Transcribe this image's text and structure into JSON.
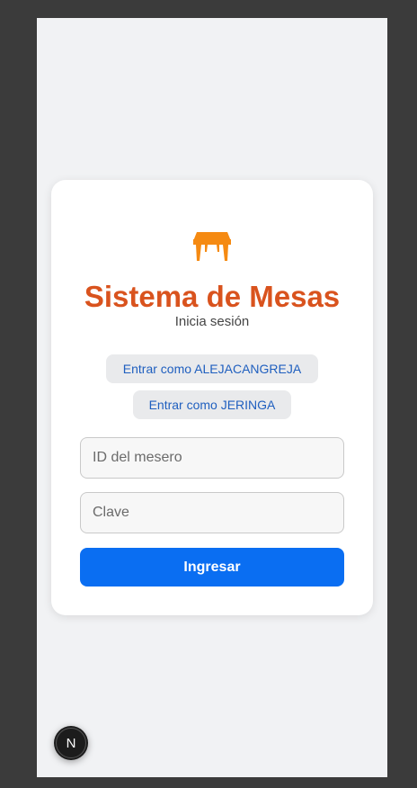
{
  "login": {
    "title": "Sistema de Mesas",
    "subtitle": "Inicia sesión",
    "quick_logins": [
      {
        "label": "Entrar como ALEJACANGREJA"
      },
      {
        "label": "Entrar como JERINGA"
      }
    ],
    "waiter_id": {
      "placeholder": "ID del mesero",
      "value": ""
    },
    "password": {
      "placeholder": "Clave",
      "value": ""
    },
    "submit_label": "Ingresar"
  },
  "dev_badge": {
    "letter": "N"
  },
  "colors": {
    "brand": "#d9531e",
    "logo": "#f58a12",
    "primary_button": "#0a6ef2",
    "link_text": "#1f5fbf"
  },
  "icons": {
    "logo": "table-icon",
    "dev_badge": "nextjs-icon"
  }
}
